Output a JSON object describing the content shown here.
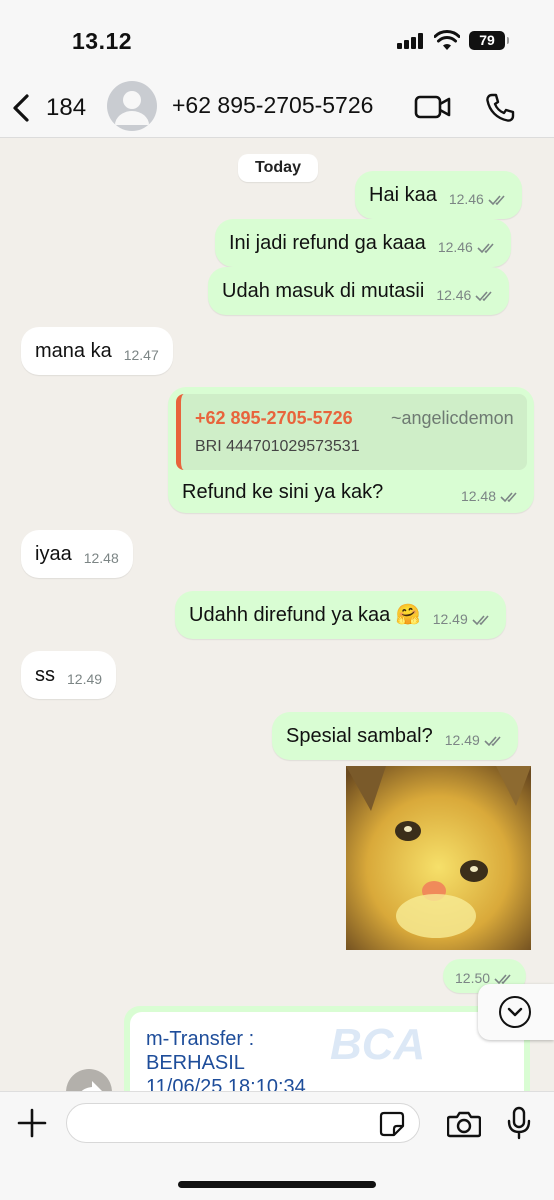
{
  "status_bar": {
    "time": "13.12",
    "battery": "79"
  },
  "header": {
    "back_count": "184",
    "contact_name": "+62 895-2705-5726"
  },
  "chat": {
    "date_label": "Today",
    "messages": [
      {
        "dir": "out",
        "text": "Hai kaa",
        "time": "12.46"
      },
      {
        "dir": "out",
        "text": "Ini jadi refund ga kaaa",
        "time": "12.46"
      },
      {
        "dir": "out",
        "text": "Udah masuk di mutasii",
        "time": "12.46"
      },
      {
        "dir": "in",
        "text": "mana ka",
        "time": "12.47"
      },
      {
        "dir": "out",
        "text": "Refund ke sini ya kak?",
        "time": "12.48",
        "quote": {
          "name": "+62 895-2705-5726",
          "alias": "~angelicdemon",
          "text": "BRI 444701029573531"
        }
      },
      {
        "dir": "in",
        "text": "iyaa",
        "time": "12.48"
      },
      {
        "dir": "out",
        "text": "Udahh direfund ya kaa 🤗",
        "time": "12.49"
      },
      {
        "dir": "in",
        "text": "ss",
        "time": "12.49"
      },
      {
        "dir": "out",
        "text": "Spesial sambal?",
        "time": "12.49"
      },
      {
        "dir": "out",
        "text": "",
        "time": "12.50"
      }
    ],
    "receipt": {
      "line1": "m-Transfer :",
      "line2": "BERHASIL",
      "line3": "11/06/25 18:10:34",
      "watermark": "BCA"
    }
  },
  "colors": {
    "outgoing_bubble": "#d9fdd3",
    "incoming_bubble": "#ffffff",
    "chat_background": "#f2efea",
    "quote_accent": "#e8643c"
  },
  "icons": [
    "back-chevron-icon",
    "avatar-icon",
    "video-call-icon",
    "phone-call-icon",
    "double-check-icon",
    "scroll-down-icon",
    "plus-icon",
    "sticker-icon",
    "camera-icon",
    "mic-icon"
  ]
}
